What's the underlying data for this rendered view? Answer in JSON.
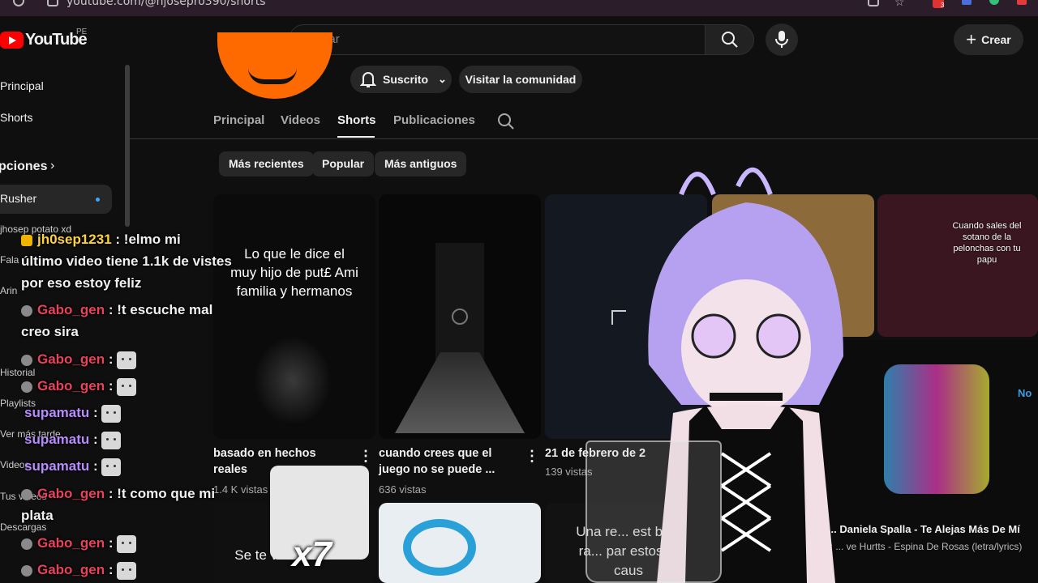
{
  "browser": {
    "url": "youtube.com/@hjosepro390/shorts",
    "extension_badge": "3"
  },
  "header": {
    "logo_text": "YouTube",
    "country": "PE",
    "search_placeholder": "Buscar",
    "create_label": "Crear"
  },
  "sidebar": {
    "items": [
      "Principal",
      "Shorts"
    ],
    "section": "Suscripciones",
    "section_visible": "pciones",
    "subs": [
      "Rusher",
      "jhosep potato xd",
      "Fala",
      "Arin"
    ],
    "lower": [
      "Historial",
      "Playlists",
      "Ver más tarde",
      "Videos",
      "Tus videos",
      "Descargas"
    ]
  },
  "channel": {
    "subscribed_label": "Suscrito",
    "community_label": "Visitar la comunidad",
    "tabs": [
      "Principal",
      "Videos",
      "Shorts",
      "Publicaciones"
    ],
    "active_tab": "Shorts",
    "chips": [
      "Más recientes",
      "Popular",
      "Más antiguos"
    ]
  },
  "shorts": [
    {
      "overlay": "Lo que le dice el muy hijo de put£ Ami familia y hermanos",
      "title_l1": "basado en hechos",
      "title_l2": "reales",
      "views": "1.4 K vistas"
    },
    {
      "overlay": "",
      "title_l1": "cuando crees que el",
      "title_l2": "juego no se puede ...",
      "views": "636 vistas"
    },
    {
      "overlay": "",
      "title_l1": "21 de febrero de 2",
      "title_l2": "",
      "views": "139 vistas"
    },
    {
      "overlay": "Cuando sales del sotano de la pelonchas con tu papu"
    }
  ],
  "shorts_row2": [
    {
      "overlay": "Se te va ... Venez..."
    },
    {
      "overlay": "Una re... est bien ra... par estos ... caus"
    }
  ],
  "music": {
    "title": "Es... Daniela Spalla - Te Alejas Más De Mí",
    "subtitle": "Mix: ... ve Hurtts - Espina De Rosas (letra/lyrics)",
    "corner": "No"
  },
  "chat": [
    {
      "user": "jh0sep1231",
      "msg": ": !elmo mi",
      "cont": "último video tiene 1.1k de vistes",
      "cont2": "por eso estoy feliz"
    },
    {
      "user": "Gabo_gen",
      "msg": ": !t escuche mal",
      "cont": "creo sira"
    },
    {
      "user": "Gabo_gen",
      "msg": ":"
    },
    {
      "user": "Gabo_gen",
      "msg": ":"
    },
    {
      "user": "supamatu",
      "msg": ":"
    },
    {
      "user": "supamatu",
      "msg": ":"
    },
    {
      "user": "supamatu",
      "msg": ":"
    },
    {
      "user": "Gabo_gen",
      "msg": ": !t como que mi",
      "cont": "plata"
    },
    {
      "user": "Gabo_gen",
      "msg": ":"
    },
    {
      "user": "Gabo_gen",
      "msg": ":"
    }
  ],
  "overlay_emote_multiplier": "x7"
}
